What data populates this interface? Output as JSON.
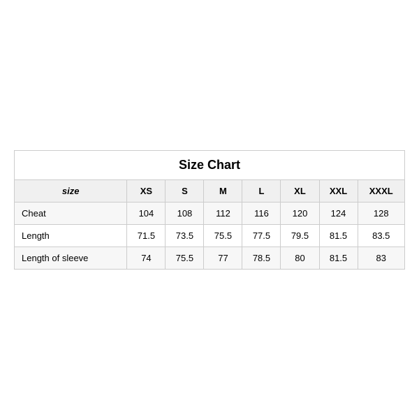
{
  "table": {
    "title": "Size Chart",
    "headers": [
      "size",
      "XS",
      "S",
      "M",
      "L",
      "XL",
      "XXL",
      "XXXL"
    ],
    "rows": [
      {
        "label": "Cheat",
        "values": [
          "104",
          "108",
          "112",
          "116",
          "120",
          "124",
          "128"
        ]
      },
      {
        "label": "Length",
        "values": [
          "71.5",
          "73.5",
          "75.5",
          "77.5",
          "79.5",
          "81.5",
          "83.5"
        ]
      },
      {
        "label": "Length of sleeve",
        "values": [
          "74",
          "75.5",
          "77",
          "78.5",
          "80",
          "81.5",
          "83"
        ]
      }
    ]
  }
}
